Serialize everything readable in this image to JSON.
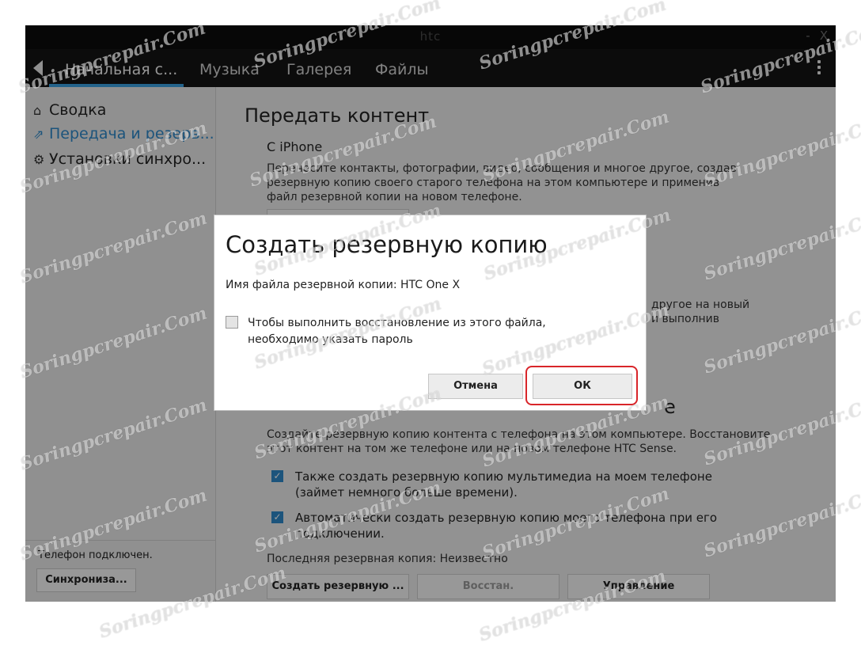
{
  "window": {
    "brand": "htc",
    "controls": [
      "-",
      "X"
    ]
  },
  "nav": {
    "tabs": [
      {
        "label": "Начальная с..."
      },
      {
        "label": "Музыка"
      },
      {
        "label": "Галерея"
      },
      {
        "label": "Файлы"
      }
    ]
  },
  "sidebar": {
    "items": [
      {
        "label": "Сводка",
        "icon": "home-icon"
      },
      {
        "label": "Передача и резерв...",
        "icon": "transfer-icon"
      },
      {
        "label": "Установки синхро...",
        "icon": "gear-icon"
      }
    ],
    "status": "Телефон подключен.",
    "sync_button": "Синхрониза..."
  },
  "main": {
    "title": "Передать контент",
    "iphone_heading": "С iPhone",
    "iphone_text": "Перенесите контакты, фотографии, видео, сообщения и многое другое, создав резервную копию своего старого телефона на этом компьютере и применив файл резервной копии на новом телефоне.",
    "transfer_text_line1": "другое на новый",
    "transfer_text_line2": "и выполнив",
    "backup_section_title": "е",
    "backup_text": "Создайте резервную копию контента с телефона на этом компьютере. Восстановите этот контент на том же телефоне или на новом телефоне HTC Sense.",
    "checkbox1": "Также создать резервную копию мультимедиа на моем телефоне (займет немного больше времени).",
    "checkbox2": "Автоматически создать резервную копию моего телефона при его подключении.",
    "last_backup": "Последняя резервная копия: Неизвестно",
    "buttons": {
      "backup": "Создать резервную ...",
      "restore": "Восстан.",
      "manage": "Управление"
    }
  },
  "dialog": {
    "title": "Создать резервную копию",
    "file_label": "Имя файла резервной копии: HTC One X",
    "password_checkbox": "Чтобы выполнить восстановление из этого файла, необходимо указать пароль",
    "cancel": "Отмена",
    "ok": "ОК"
  },
  "watermark": "Soringpcrepair.Com",
  "colors": {
    "accent": "#2e88c8",
    "tab_underline": "#3aa0e0",
    "highlight": "#d9252a"
  }
}
